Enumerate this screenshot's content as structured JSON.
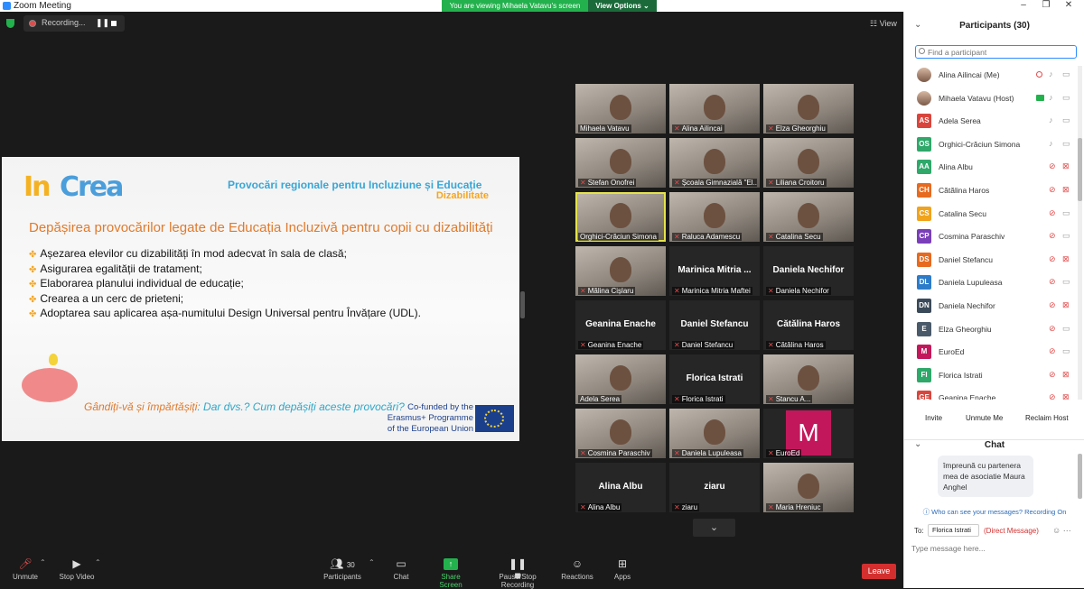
{
  "window": {
    "title": "Zoom Meeting",
    "minimize": "–",
    "maximize": "❐",
    "close": "✕"
  },
  "banner": {
    "viewing": "You are viewing Mihaela Vatavu's screen",
    "view_options": "View Options ⌄"
  },
  "top": {
    "recording": "Recording...",
    "pause": "❚❚",
    "view": "☷ View"
  },
  "slide": {
    "logo_in": "In",
    "logo_crea": "Crea",
    "title": "Provocări regionale pentru Incluziune și Educație",
    "subtitle": "Dizabilitate",
    "heading": "Depășirea provocărilor legate de Educația Incluzivă pentru copii cu dizabilități",
    "bullets": [
      "Așezarea elevilor cu dizabilități în mod adecvat în sala de clasă;",
      "Asigurarea egalității de tratament;",
      "Elaborarea planului individual de educație;",
      "Crearea a un cerc de prieteni;",
      "Adoptarea sau aplicarea așa-numitului Design Universal pentru Învățare (UDL)."
    ],
    "question_orange": "Gândiți-vă și împărtășiți",
    "question_rest": ": Dar dvs.? Cum depășiți aceste provocări?",
    "cofund_1": "Co-funded by the",
    "cofund_2": "Erasmus+ Programme",
    "cofund_3": "of the European Union"
  },
  "gallery": [
    {
      "name": "Mihaela Vatavu",
      "kind": "video",
      "muted": false
    },
    {
      "name": "Alina Ailincai",
      "kind": "video",
      "muted": true
    },
    {
      "name": "Elza Gheorghiu",
      "kind": "video",
      "muted": true
    },
    {
      "name": "Stefan Onofrei",
      "kind": "video",
      "muted": true
    },
    {
      "name": "Școala Gimnazială \"El...",
      "kind": "video",
      "muted": true
    },
    {
      "name": "Liliana Croitoru",
      "kind": "video",
      "muted": true
    },
    {
      "name": "Orghici-Crăciun Simona",
      "kind": "video",
      "muted": false,
      "highlight": true
    },
    {
      "name": "Raluca Adamescu",
      "kind": "video",
      "muted": true
    },
    {
      "name": "Catalina Secu",
      "kind": "video",
      "muted": true
    },
    {
      "name": "Mălina Cișlaru",
      "kind": "video",
      "muted": true
    },
    {
      "name": "Marinica Mitria Maftei",
      "big": "Marinica  Mitria ...",
      "kind": "name",
      "muted": true
    },
    {
      "name": "Daniela Nechifor",
      "big": "Daniela Nechifor",
      "kind": "name",
      "muted": true
    },
    {
      "name": "Geanina Enache",
      "big": "Geanina Enache",
      "kind": "name",
      "muted": true
    },
    {
      "name": "Daniel Stefancu",
      "big": "Daniel Stefancu",
      "kind": "name",
      "muted": true
    },
    {
      "name": "Cătălina Haros",
      "big": "Cătălina Haros",
      "kind": "name",
      "muted": true
    },
    {
      "name": "Adela Serea",
      "kind": "video",
      "muted": false
    },
    {
      "name": "Florica Istrati",
      "big": "Florica Istrati",
      "kind": "name",
      "muted": true
    },
    {
      "name": "Stancu A...",
      "kind": "video",
      "muted": true
    },
    {
      "name": "Cosmina Paraschiv",
      "kind": "video",
      "muted": true
    },
    {
      "name": "Daniela Lupuleasa",
      "kind": "video",
      "muted": true
    },
    {
      "name": "EuroEd",
      "kind": "logo",
      "letter": "M",
      "muted": true
    },
    {
      "name": "Alina Albu",
      "big": "Alina Albu",
      "kind": "name",
      "muted": true
    },
    {
      "name": "ziaru",
      "big": "ziaru",
      "kind": "name",
      "muted": true
    },
    {
      "name": "Maria Hreniuc",
      "kind": "video",
      "muted": true
    }
  ],
  "gallery_more": "⌄",
  "toolbar": {
    "unmute": "Unmute",
    "stop_video": "Stop Video",
    "participants": "Participants",
    "participants_count": "30",
    "chat": "Chat",
    "share": "Share Screen",
    "pause_rec": "Pause/Stop Recording",
    "reactions": "Reactions",
    "apps": "Apps",
    "leave": "Leave"
  },
  "panel": {
    "title": "Participants (30)",
    "search_placeholder": "Find a participant",
    "participants": [
      {
        "name": "Alina Ailincai (Me)",
        "initials": "",
        "color": "",
        "photo": true,
        "mic": "on",
        "cam": "on",
        "badge": "rec"
      },
      {
        "name": "Mihaela Vatavu (Host)",
        "initials": "",
        "color": "",
        "photo": true,
        "mic": "on",
        "cam": "on",
        "badge": "share"
      },
      {
        "name": "Adela Serea",
        "initials": "AS",
        "color": "#d9453c",
        "mic": "on",
        "cam": "on"
      },
      {
        "name": "Orghici-Crăciun Simona",
        "initials": "OS",
        "color": "#2fa86a",
        "mic": "on",
        "cam": "on"
      },
      {
        "name": "Alina Albu",
        "initials": "AA",
        "color": "#2fa86a",
        "mic": "muted",
        "cam": "muted"
      },
      {
        "name": "Cătălina Haros",
        "initials": "CH",
        "color": "#e66a1f",
        "mic": "muted",
        "cam": "muted"
      },
      {
        "name": "Catalina Secu",
        "initials": "CS",
        "color": "#f0a31c",
        "mic": "muted",
        "cam": "on"
      },
      {
        "name": "Cosmina Paraschiv",
        "initials": "CP",
        "color": "#7a3fb8",
        "mic": "muted",
        "cam": "on"
      },
      {
        "name": "Daniel Stefancu",
        "initials": "DS",
        "color": "#e66a1f",
        "mic": "muted",
        "cam": "muted"
      },
      {
        "name": "Daniela Lupuleasa",
        "initials": "DL",
        "color": "#2d7cc9",
        "mic": "muted",
        "cam": "on"
      },
      {
        "name": "Daniela Nechifor",
        "initials": "DN",
        "color": "#3b4a5a",
        "mic": "muted",
        "cam": "muted"
      },
      {
        "name": "Elza Gheorghiu",
        "initials": "E",
        "color": "#4a5a6a",
        "mic": "muted",
        "cam": "on"
      },
      {
        "name": "EuroEd",
        "initials": "M",
        "color": "#c2185b",
        "mic": "muted",
        "cam": "on"
      },
      {
        "name": "Florica Istrati",
        "initials": "FI",
        "color": "#2fa86a",
        "mic": "muted",
        "cam": "muted"
      },
      {
        "name": "Geanina Enache",
        "initials": "GE",
        "color": "#d9453c",
        "mic": "muted",
        "cam": "muted"
      }
    ],
    "invite": "Invite",
    "unmute_me": "Unmute Me",
    "reclaim_host": "Reclaim Host",
    "chat_title": "Chat",
    "chat_message": "împreună cu partenera mea de asociatie Maura Anghel",
    "privacy": "Who can see your messages? Recording On",
    "to_label": "To:",
    "to_value": "Florica Istrati ⌄",
    "dm": "(Direct Message)",
    "input_placeholder": "Type message here..."
  }
}
